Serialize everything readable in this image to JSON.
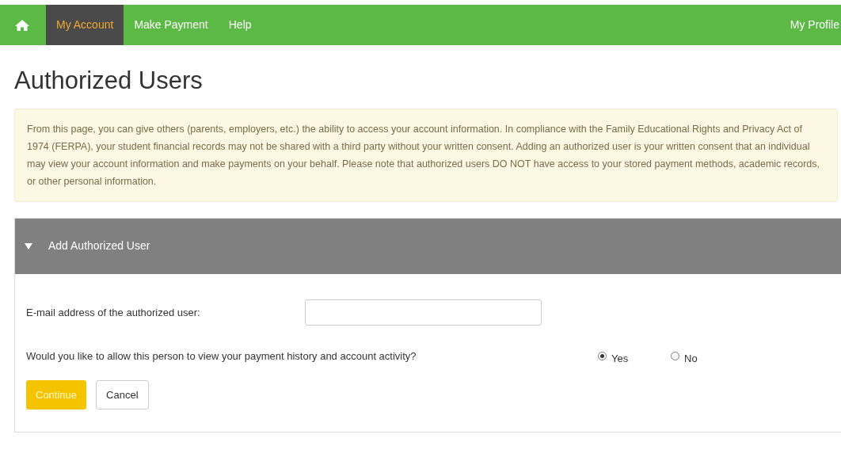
{
  "nav": {
    "items": [
      {
        "label": "My Account",
        "selected": true
      },
      {
        "label": "Make Payment",
        "selected": false
      },
      {
        "label": "Help",
        "selected": false
      }
    ],
    "right": "My Profile"
  },
  "title": "Authorized Users",
  "notice": "From this page, you can give others (parents, employers, etc.) the ability to access your account information. In compliance with the Family Educational Rights and Privacy Act of 1974 (FERPA), your student financial records may not be shared with a third party without your written consent. Adding an authorized user is your written consent that an individual may view your account information and make payments on your behalf. Please note that authorized users DO NOT have access to your stored payment methods, academic records, or other personal information.",
  "panel": {
    "title": "Add Authorized User",
    "expanded": true,
    "email_label": "E-mail address of the authorized user:",
    "question": "Would you like to allow this person to view your payment history and account activity?",
    "options": [
      {
        "label": "Yes",
        "selected": true
      },
      {
        "label": "No",
        "selected": false
      }
    ],
    "buttons": [
      {
        "label": "Continue",
        "kind": "primary"
      },
      {
        "label": "Cancel",
        "kind": "secondary"
      }
    ]
  }
}
